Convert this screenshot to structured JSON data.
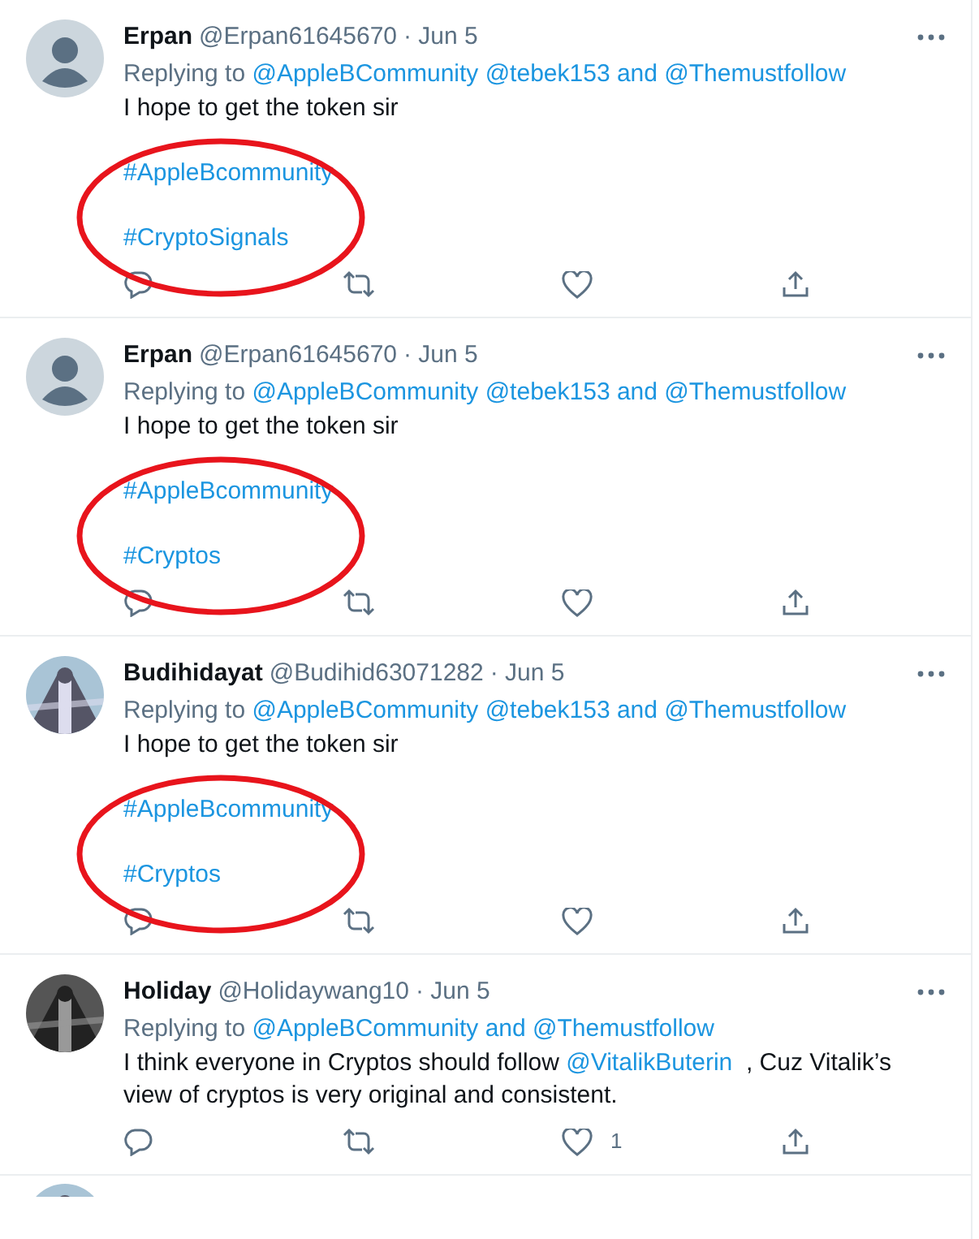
{
  "tweets": [
    {
      "name": "Erpan",
      "handle": "@Erpan61645670",
      "date": "· Jun 5",
      "avatar": {
        "kind": "default"
      },
      "replying_prefix": "Replying to",
      "replying_to": "@AppleBCommunity @tebek153 and @Themustfollow",
      "annotated": true,
      "paragraphs": [
        [
          {
            "kind": "text",
            "text": "I hope to get the token sir"
          }
        ],
        [
          {
            "kind": "hashtag",
            "text": "#AppleBcommunity"
          }
        ],
        [
          {
            "kind": "hashtag",
            "text": "#CryptoSignals"
          }
        ]
      ]
    },
    {
      "name": "Erpan",
      "handle": "@Erpan61645670",
      "date": "· Jun 5",
      "avatar": {
        "kind": "default"
      },
      "replying_prefix": "Replying to",
      "replying_to": "@AppleBCommunity @tebek153 and @Themustfollow",
      "annotated": true,
      "paragraphs": [
        [
          {
            "kind": "text",
            "text": "I hope to get the token sir"
          }
        ],
        [
          {
            "kind": "hashtag",
            "text": "#AppleBcommunity"
          }
        ],
        [
          {
            "kind": "hashtag",
            "text": "#Cryptos"
          }
        ]
      ]
    },
    {
      "name": "Budihidayat",
      "handle": "@Budihid63071282",
      "date": "· Jun 5",
      "avatar": {
        "kind": "picture"
      },
      "replying_prefix": "Replying to",
      "replying_to": "@AppleBCommunity @tebek153 and @Themustfollow",
      "annotated": true,
      "paragraphs": [
        [
          {
            "kind": "text",
            "text": "I hope to get the token sir"
          }
        ],
        [
          {
            "kind": "hashtag",
            "text": "#AppleBcommunity"
          }
        ],
        [
          {
            "kind": "hashtag",
            "text": "#Cryptos"
          }
        ]
      ]
    },
    {
      "name": "Holiday",
      "handle": "@Holidaywang10",
      "date": "· Jun 5",
      "avatar": {
        "kind": "picture"
      },
      "replying_prefix": "Replying to",
      "replying_to": "@AppleBCommunity and @Themustfollow",
      "annotated": false,
      "like_count": "1",
      "paragraphs": [
        [
          {
            "kind": "text",
            "text": "I think everyone in Cryptos should follow "
          },
          {
            "kind": "mention",
            "text": "@VitalikButerin"
          },
          {
            "kind": "text",
            "text": "  , Cuz Vitalik’s view of cryptos is very original and consistent."
          }
        ]
      ]
    }
  ],
  "next_tweet": {
    "avatar": {
      "kind": "picture"
    }
  }
}
